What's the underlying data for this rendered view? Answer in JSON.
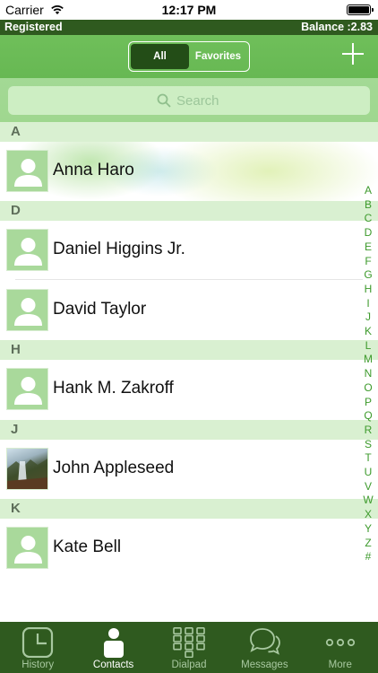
{
  "status_bar": {
    "carrier": "Carrier",
    "time": "12:17 PM",
    "battery_level": 1.0
  },
  "registration": {
    "status": "Registered",
    "balance": "Balance :2.83"
  },
  "header": {
    "segments": [
      "All",
      "Favorites"
    ],
    "selected_segment": "All"
  },
  "search": {
    "placeholder": "Search"
  },
  "sections": [
    {
      "letter": "A",
      "contacts": [
        {
          "name": "Anna Haro",
          "has_photo": false
        }
      ]
    },
    {
      "letter": "D",
      "contacts": [
        {
          "name": "Daniel Higgins Jr.",
          "has_photo": false
        },
        {
          "name": "David Taylor",
          "has_photo": false
        }
      ]
    },
    {
      "letter": "H",
      "contacts": [
        {
          "name": "Hank M. Zakroff",
          "has_photo": false
        }
      ]
    },
    {
      "letter": "J",
      "contacts": [
        {
          "name": "John Appleseed",
          "has_photo": true
        }
      ]
    },
    {
      "letter": "K",
      "contacts": [
        {
          "name": "Kate Bell",
          "has_photo": false
        }
      ]
    }
  ],
  "index_letters": [
    "A",
    "B",
    "C",
    "D",
    "E",
    "F",
    "G",
    "H",
    "I",
    "J",
    "K",
    "L",
    "M",
    "N",
    "O",
    "P",
    "Q",
    "R",
    "S",
    "T",
    "U",
    "V",
    "W",
    "X",
    "Y",
    "Z",
    "#"
  ],
  "tabs": [
    {
      "label": "History",
      "icon": "clock-icon"
    },
    {
      "label": "Contacts",
      "icon": "contacts-icon"
    },
    {
      "label": "Dialpad",
      "icon": "dialpad-icon"
    },
    {
      "label": "Messages",
      "icon": "messages-icon"
    },
    {
      "label": "More",
      "icon": "more-icon"
    }
  ],
  "active_tab": "Contacts",
  "colors": {
    "header_green": "#6fbf5a",
    "dark_green": "#2f5a1f",
    "section_bg": "#d9f0d1",
    "index_green": "#3d9a2c"
  }
}
